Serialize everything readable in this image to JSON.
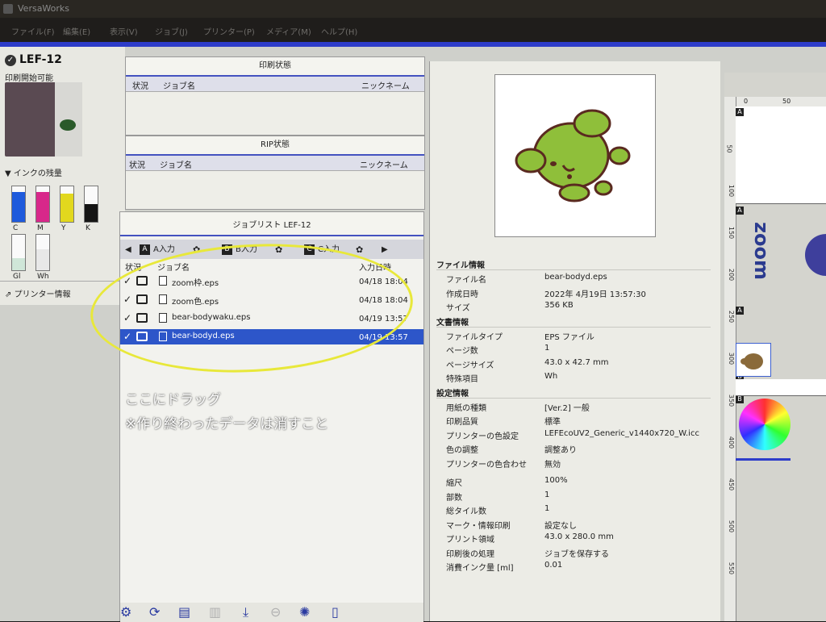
{
  "app": {
    "title": "VersaWorks"
  },
  "menu": [
    "ファイル(F)",
    "編集(E)",
    "表示(V)",
    "ジョブ(J)",
    "プリンター(P)",
    "メディア(M)",
    "ヘルプ(H)"
  ],
  "printer": {
    "name": "LEF-12",
    "status": "印刷開始可能",
    "ink_title": "▼ インクの残量",
    "inks": [
      {
        "label": "C",
        "color": "#1e5adc",
        "level": 0.85
      },
      {
        "label": "M",
        "color": "#d8288a",
        "level": 0.85
      },
      {
        "label": "Y",
        "color": "#e2d81e",
        "level": 0.8
      },
      {
        "label": "K",
        "color": "#151515",
        "level": 0.5
      },
      {
        "label": "Gl",
        "color": "#cfe6d8",
        "level": 0.35
      },
      {
        "label": "Wh",
        "color": "#e8e8e8",
        "level": 0.6
      }
    ],
    "info_label": "プリンター情報"
  },
  "print_status": {
    "title": "印刷状態",
    "col_status": "状況",
    "col_job": "ジョブ名",
    "col_nick": "ニックネーム"
  },
  "rip_status": {
    "title": "RIP状態",
    "col_status": "状況",
    "col_job": "ジョブ名",
    "col_nick": "ニックネーム"
  },
  "joblist": {
    "title": "ジョブリスト LEF-12",
    "tabs": [
      "A入力",
      "B入力",
      "C入力"
    ],
    "tab_letters": [
      "A",
      "B",
      "C"
    ],
    "col_status": "状況",
    "col_job": "ジョブ名",
    "col_date": "入力日時",
    "rows": [
      {
        "name": "zoom枠.eps",
        "date": "04/18 18:04",
        "selected": false
      },
      {
        "name": "zoom色.eps",
        "date": "04/18 18:04",
        "selected": false
      },
      {
        "name": "bear-bodywaku.eps",
        "date": "04/19 13:57",
        "selected": false
      },
      {
        "name": "bear-bodyd.eps",
        "date": "04/19 13:57",
        "selected": true
      }
    ],
    "annotation_line1": "ここにドラッグ",
    "annotation_line2": "※作り終わったデータは消すこと"
  },
  "file_info": {
    "section_file": "ファイル情報",
    "file_rows": [
      {
        "k": "ファイル名",
        "v": "bear-bodyd.eps"
      },
      {
        "k": "作成日時",
        "v": "2022年 4月19日 13:57:30"
      },
      {
        "k": "サイズ",
        "v": "356 KB"
      }
    ],
    "section_doc": "文書情報",
    "doc_rows": [
      {
        "k": "ファイルタイプ",
        "v": "EPS ファイル"
      },
      {
        "k": "ページ数",
        "v": "1"
      },
      {
        "k": "ページサイズ",
        "v": "43.0 x 42.7 mm"
      },
      {
        "k": "特殊項目",
        "v": "Wh"
      }
    ],
    "section_settings": "設定情報",
    "settings_rows": [
      {
        "k": "用紙の種類",
        "v": "[Ver.2] 一般"
      },
      {
        "k": "印刷品質",
        "v": "標準"
      },
      {
        "k": "プリンターの色設定",
        "v": "LEFEcoUV2_Generic_v1440x720_W.icc"
      },
      {
        "k": "色の調整",
        "v": "調整あり"
      },
      {
        "k": "プリンターの色合わせ",
        "v": "無効"
      }
    ],
    "extra_rows": [
      {
        "k": "縮尺",
        "v": "100%"
      },
      {
        "k": "部数",
        "v": "1"
      },
      {
        "k": "総タイル数",
        "v": "1"
      },
      {
        "k": "マーク・情報印刷",
        "v": "設定なし"
      },
      {
        "k": "プリント領域",
        "v": "43.0 x 280.0 mm"
      },
      {
        "k": "印刷後の処理",
        "v": "ジョブを保存する"
      },
      {
        "k": "消費インク量 [ml]",
        "v": "0.01"
      }
    ]
  },
  "ruler": {
    "top_labels": [
      "0",
      "50"
    ],
    "left_labels": [
      "50",
      "100",
      "150",
      "200",
      "250",
      "300",
      "350",
      "400",
      "450",
      "500",
      "550"
    ],
    "marker_letters": [
      "A",
      "A",
      "A",
      "A",
      "B",
      "B"
    ],
    "media_text": "zoom"
  }
}
